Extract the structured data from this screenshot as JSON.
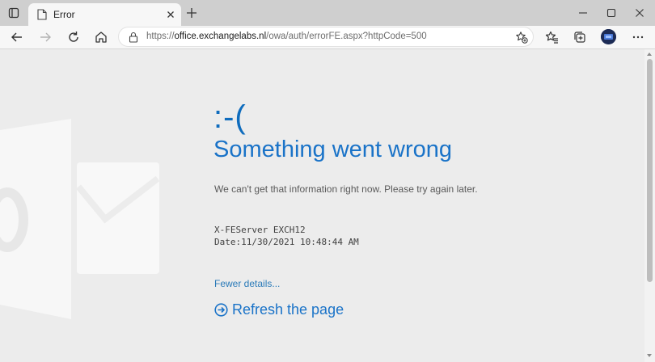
{
  "browser": {
    "tab": {
      "title": "Error"
    },
    "address": {
      "scheme": "https://",
      "host": "office.exchangelabs.nl",
      "path": "/owa/auth/errorFE.aspx?httpCode=500"
    }
  },
  "page": {
    "emoticon": ":-(",
    "heading": "Something went wrong",
    "message": "We can't get that information right now. Please try again later.",
    "server_line": "X-FEServer EXCH12",
    "date_line": "Date:11/30/2021 10:48:44 AM",
    "fewer_details": "Fewer details...",
    "refresh": "Refresh the page"
  },
  "colors": {
    "accent": "#1a73c8",
    "link": "#2a7ab8",
    "background": "#ececec"
  },
  "icons": [
    "tab-actions-icon",
    "page-icon",
    "close-icon",
    "plus-icon",
    "minimize-icon",
    "maximize-icon",
    "window-close-icon",
    "back-icon",
    "forward-icon",
    "reload-icon",
    "home-icon",
    "lock-icon",
    "add-favorite-icon",
    "favorites-icon",
    "collections-icon",
    "more-icon",
    "refresh-circle-arrow-icon",
    "outlook-logo"
  ]
}
